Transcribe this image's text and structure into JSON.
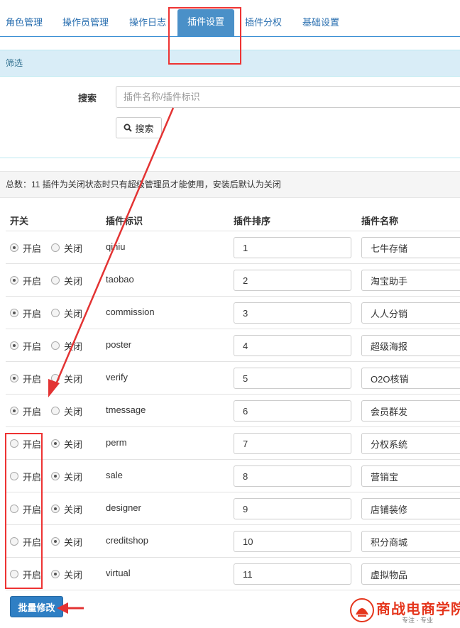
{
  "tabs": [
    {
      "label": "角色管理",
      "active": false
    },
    {
      "label": "操作员管理",
      "active": false
    },
    {
      "label": "操作日志",
      "active": false
    },
    {
      "label": "插件设置",
      "active": true
    },
    {
      "label": "插件分权",
      "active": false
    },
    {
      "label": "基础设置",
      "active": false
    }
  ],
  "filter": {
    "title": "筛选",
    "search_label": "搜索",
    "search_placeholder": "插件名称/插件标识",
    "search_value": "",
    "search_button": "搜索"
  },
  "summary": "总数：11 插件为关闭状态时只有超级管理员才能使用，安装后默认为关闭",
  "table": {
    "headers": [
      "开关",
      "插件标识",
      "插件排序",
      "插件名称"
    ],
    "on_label": "开启",
    "off_label": "关闭",
    "rows": [
      {
        "ident": "qiniu",
        "order": "1",
        "name": "七牛存储",
        "enabled": true
      },
      {
        "ident": "taobao",
        "order": "2",
        "name": "淘宝助手",
        "enabled": true
      },
      {
        "ident": "commission",
        "order": "3",
        "name": "人人分销",
        "enabled": true
      },
      {
        "ident": "poster",
        "order": "4",
        "name": "超级海报",
        "enabled": true
      },
      {
        "ident": "verify",
        "order": "5",
        "name": "O2O核销",
        "enabled": true
      },
      {
        "ident": "tmessage",
        "order": "6",
        "name": "会员群发",
        "enabled": true
      },
      {
        "ident": "perm",
        "order": "7",
        "name": "分权系统",
        "enabled": false
      },
      {
        "ident": "sale",
        "order": "8",
        "name": "营销宝",
        "enabled": false
      },
      {
        "ident": "designer",
        "order": "9",
        "name": "店铺装修",
        "enabled": false
      },
      {
        "ident": "creditshop",
        "order": "10",
        "name": "积分商城",
        "enabled": false
      },
      {
        "ident": "virtual",
        "order": "11",
        "name": "虚拟物品",
        "enabled": false
      }
    ]
  },
  "batch_button": "批量修改",
  "logo": {
    "text": "商战电商学院",
    "sub": "专注 · 专业"
  },
  "colors": {
    "accent": "#4a90c8",
    "annotation": "#e33333",
    "logo": "#e5361d"
  }
}
